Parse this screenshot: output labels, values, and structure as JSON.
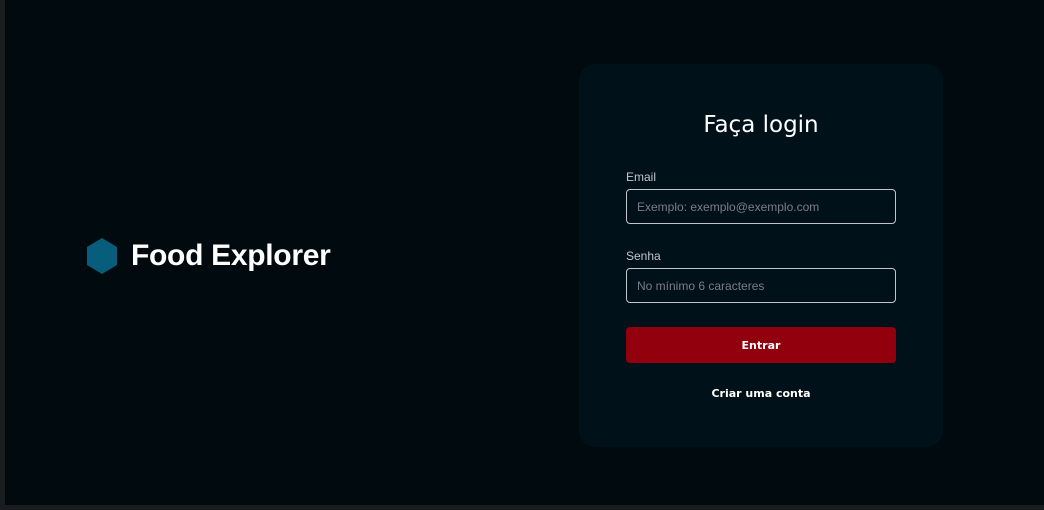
{
  "brand": {
    "name": "Food Explorer",
    "icon": "hexagon-icon",
    "icon_color": "#065e7c"
  },
  "login": {
    "title": "Faça login",
    "email": {
      "label": "Email",
      "value": "",
      "placeholder": "Exemplo: exemplo@exemplo.com"
    },
    "password": {
      "label": "Senha",
      "value": "",
      "placeholder": "No mínimo 6 caracteres"
    },
    "submit_label": "Entrar",
    "create_account_label": "Criar uma conta"
  },
  "colors": {
    "page_background": "#000a0f",
    "card_background": "#001119",
    "primary_button": "#92000e",
    "text": "#ffffff",
    "input_border": "#c4c4cc"
  }
}
